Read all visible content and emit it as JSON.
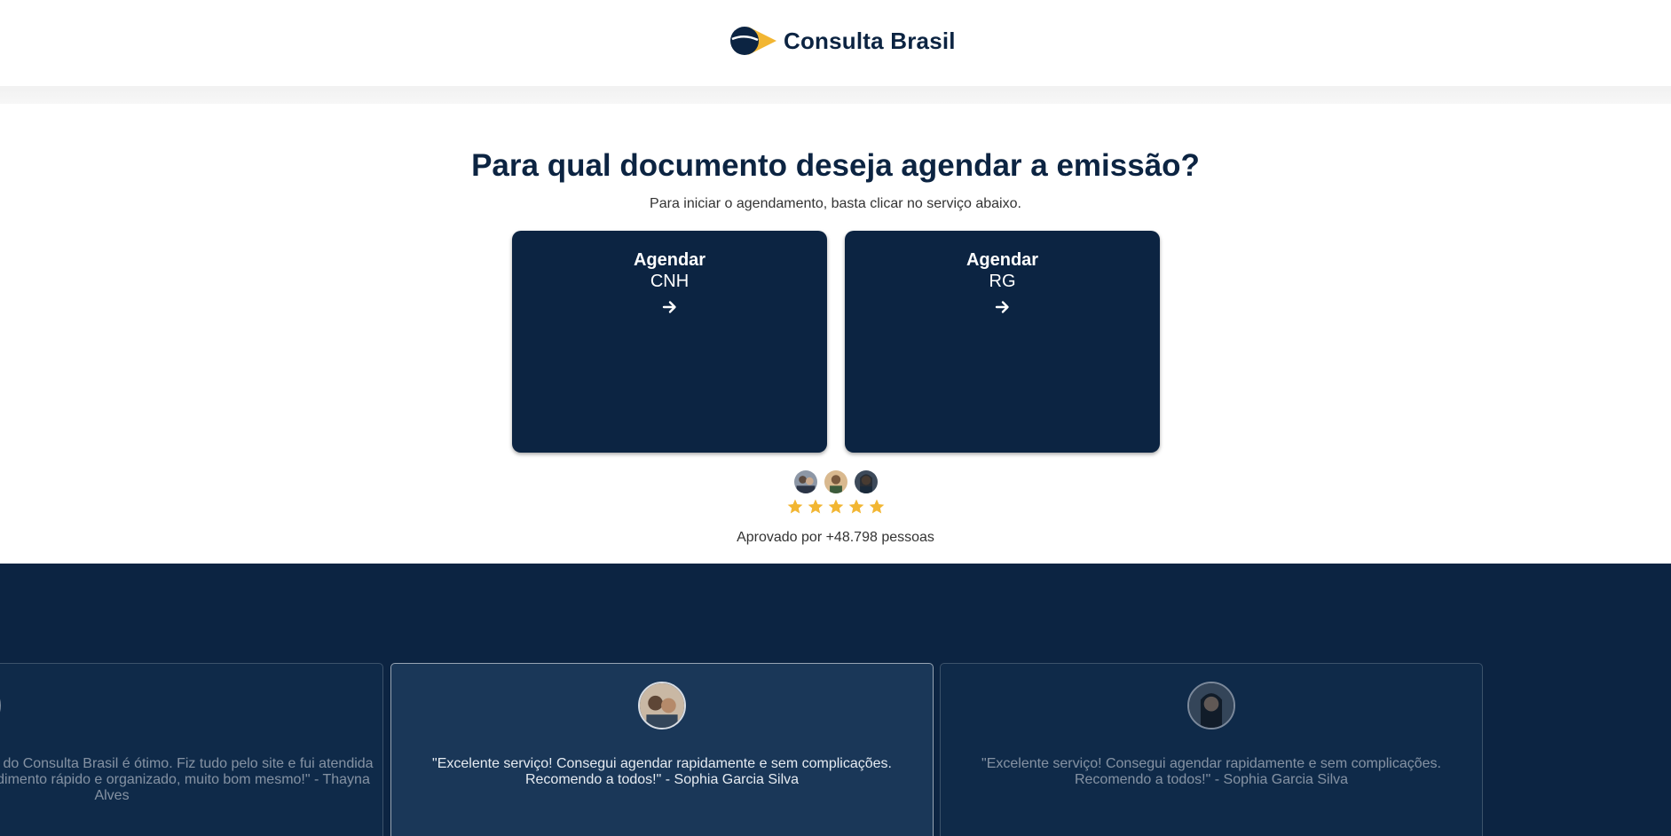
{
  "header": {
    "logo_text": "Consulta Brasil",
    "logo_icon": "consulta-brasil-logo-icon"
  },
  "main": {
    "headline": "Para qual documento deseja agendar a emissão?",
    "subline": "Para iniciar o agendamento, basta clicar no serviço abaixo.",
    "cards": [
      {
        "title": "Agendar",
        "doc": "CNH",
        "icon": "arrow-right-icon"
      },
      {
        "title": "Agendar",
        "doc": "RG",
        "icon": "arrow-right-icon"
      }
    ],
    "rating": {
      "stars": 5,
      "max": 5
    },
    "approved_text": "Aprovado por +48.798 pessoas"
  },
  "testimonials": [
    {
      "text": "\"O agendamento online do Consulta Brasil é ótimo. Fiz tudo pelo site e fui atendida na data marcada. Atendimento rápido e organizado, muito bom mesmo!\" - Thayna Alves"
    },
    {
      "text": "\"Excelente serviço! Consegui agendar rapidamente e sem complicações. Recomendo a todos!\" - Sophia Garcia Silva"
    },
    {
      "text": "\"Excelente serviço! Consegui agendar rapidamente e sem complicações. Recomendo a todos!\" - Sophia Garcia Silva"
    }
  ],
  "colors": {
    "navy": "#0c2442",
    "gold": "#f2b632",
    "white": "#ffffff"
  }
}
